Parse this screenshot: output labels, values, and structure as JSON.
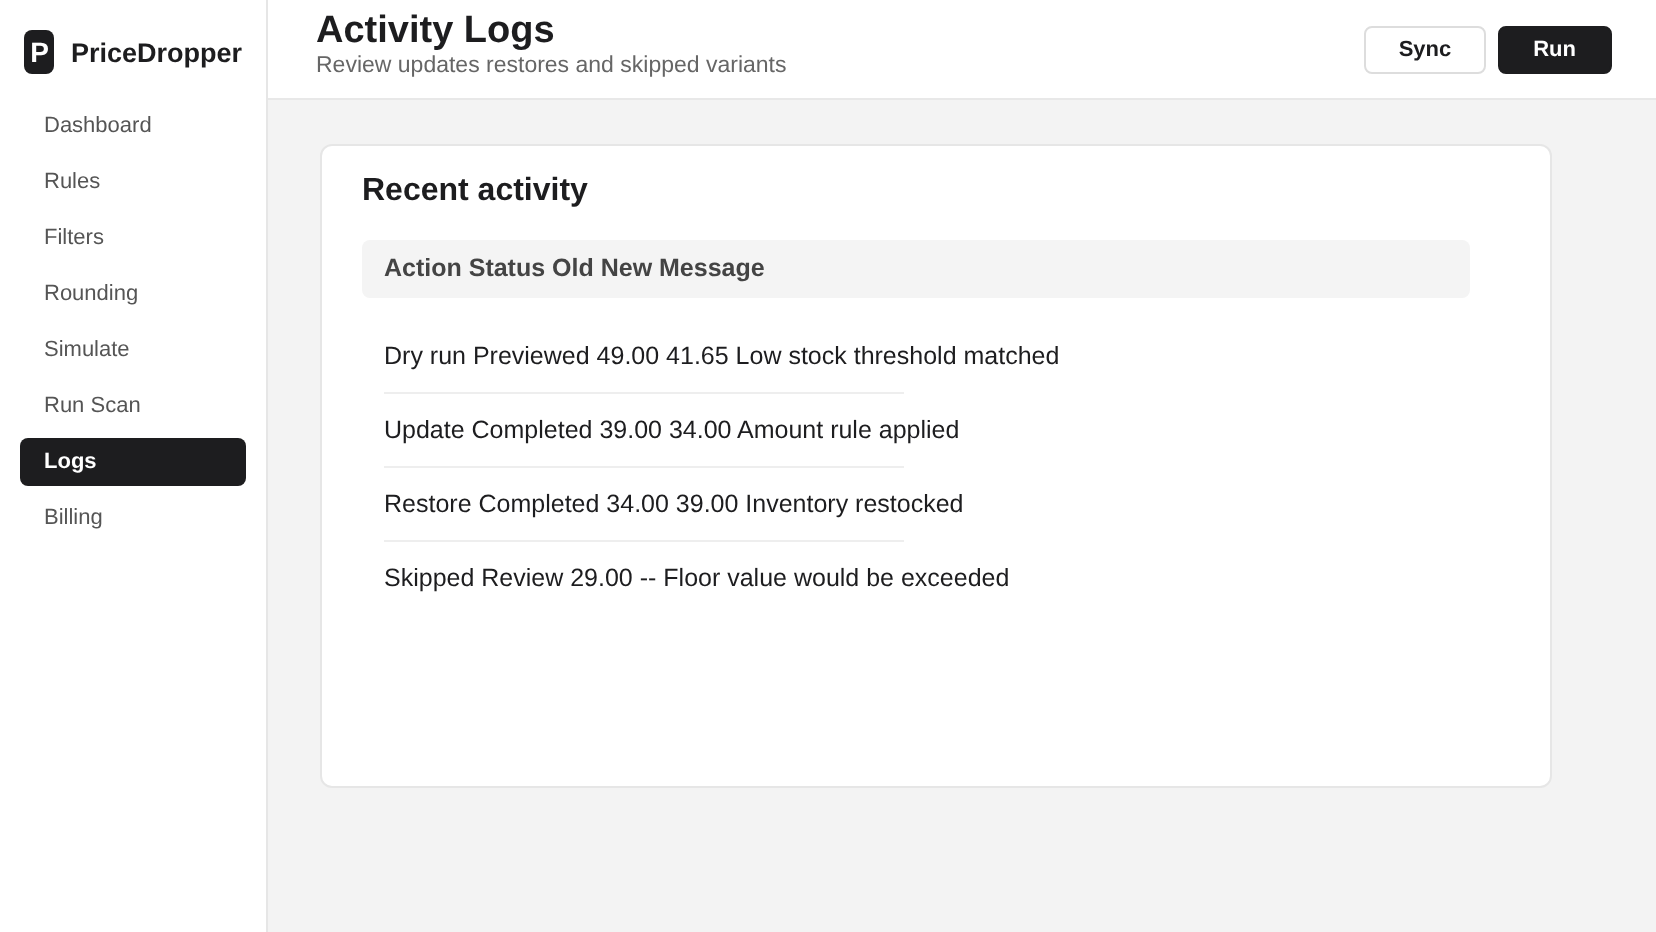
{
  "brand": {
    "logo": "P",
    "name": "PriceDropper"
  },
  "sidebar": {
    "items": [
      {
        "label": "Dashboard",
        "selected": false
      },
      {
        "label": "Rules",
        "selected": false
      },
      {
        "label": "Filters",
        "selected": false
      },
      {
        "label": "Rounding",
        "selected": false
      },
      {
        "label": "Simulate",
        "selected": false
      },
      {
        "label": "Run Scan",
        "selected": false
      },
      {
        "label": "Logs",
        "selected": true
      },
      {
        "label": "Billing",
        "selected": false
      }
    ]
  },
  "header": {
    "title": "Activity Logs",
    "subtitle": "Review updates restores and skipped variants",
    "buttons": [
      {
        "label": "Sync",
        "kind": "secondary"
      },
      {
        "label": "Run",
        "kind": "primary"
      }
    ]
  },
  "card": {
    "title": "Recent activity",
    "table_header": "Action Status Old New Message",
    "rows": [
      "Dry run Previewed 49.00 41.65 Low stock threshold matched",
      "Update Completed 39.00 34.00 Amount rule applied",
      "Restore Completed 34.00 39.00 Inventory restocked",
      "Skipped Review 29.00 -- Floor value would be exceeded"
    ]
  }
}
